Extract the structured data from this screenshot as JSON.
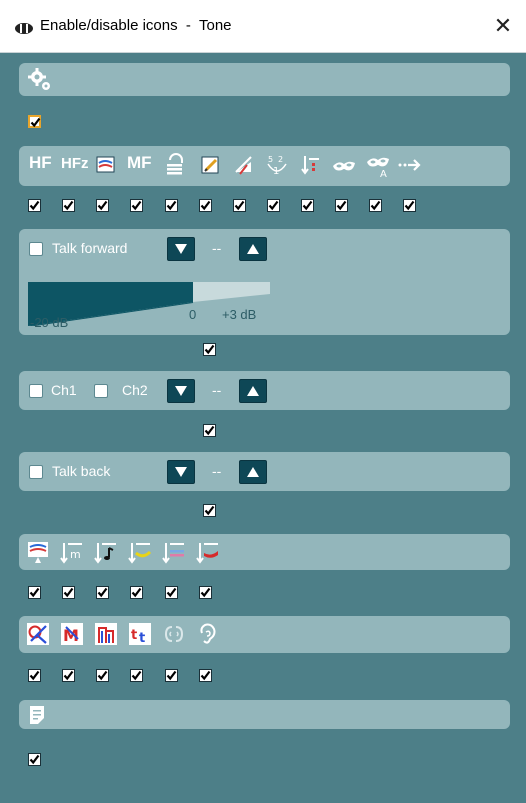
{
  "window": {
    "title": "Enable/disable icons  -  Tone",
    "close_glyph": "✕",
    "title_icon": "headset-icon"
  },
  "sections": {
    "settings": {
      "icons": [
        "settings-gears-icon"
      ],
      "checked": [
        true
      ]
    },
    "toolbar": {
      "icons": [
        {
          "name": "hf-icon",
          "text": "HF"
        },
        {
          "name": "hfz-icon",
          "text": "HFz"
        },
        {
          "name": "masking-mode-icon"
        },
        {
          "name": "mf-icon",
          "text": "MF"
        },
        {
          "name": "stimulus-stack-icon"
        },
        {
          "name": "notes-edit-icon"
        },
        {
          "name": "auto-mark-icon"
        },
        {
          "name": "multi-frequency-icon"
        },
        {
          "name": "marker-select-icon"
        },
        {
          "name": "mask-icon"
        },
        {
          "name": "mask-auto-icon"
        },
        {
          "name": "more-arrow-icon"
        }
      ],
      "checked": [
        true,
        true,
        true,
        true,
        true,
        true,
        true,
        true,
        true,
        true,
        true,
        true
      ]
    },
    "talk_forward": {
      "label": "Talk forward",
      "value": "--",
      "scale": {
        "min": "-20 dB",
        "mid": "0",
        "max": "+3 dB"
      },
      "enabled_checked": true
    },
    "channels": {
      "ch1": "Ch1",
      "ch2": "Ch2",
      "value": "--",
      "enabled_checked": true
    },
    "talk_back": {
      "label": "Talk back",
      "value": "--",
      "enabled_checked": true
    },
    "stimulus": {
      "icons": [
        "monitor-stimulus-icon",
        "m-stimulus-icon",
        "note-stimulus-icon",
        "yellow-stimulus-icon",
        "blue-stimulus-icon",
        "red-stimulus-icon"
      ],
      "checked": [
        true,
        true,
        true,
        true,
        true,
        true
      ]
    },
    "transducers": {
      "icons": [
        "no-response-icon",
        "masked-m-icon",
        "masked-bone-icon",
        "tt-icon",
        "binaural-ear-icon",
        "ear-icon"
      ],
      "checked": [
        true,
        true,
        true,
        true,
        true,
        true
      ]
    },
    "notes": {
      "icons": [
        "notes-icon"
      ],
      "checked": [
        true
      ]
    }
  },
  "colors": {
    "background": "#4d7f88",
    "panel": "#93b6bb",
    "button_dark": "#0e4756",
    "slider_fill": "#0d5564",
    "checkbox_highlight": "#e8a52c"
  }
}
